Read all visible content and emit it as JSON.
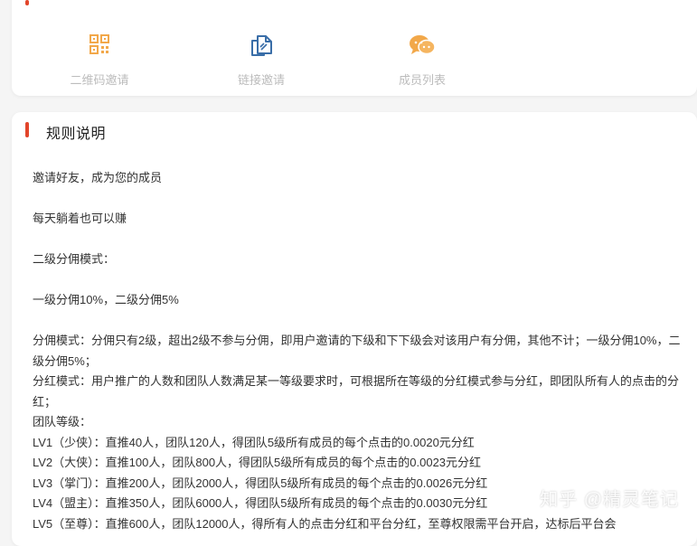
{
  "actions": {
    "qr_invite": {
      "label": "二维码邀请",
      "icon": "qr-code-icon",
      "color": "#f2a84a"
    },
    "link_invite": {
      "label": "链接邀请",
      "icon": "copy-link-icon",
      "color": "#3a6ea8"
    },
    "member_list": {
      "label": "成员列表",
      "icon": "chat-bubbles-icon",
      "color": "#f2a84a"
    }
  },
  "rules": {
    "title": "规则说明",
    "accent_color": "#e2452b",
    "lines": [
      "邀请好友，成为您的成员",
      "每天躺着也可以赚",
      "二级分佣模式：",
      "一级分佣10%，二级分佣5%",
      "分佣模式：分佣只有2级，超出2级不参与分佣，即用户邀请的下级和下下级会对该用户有分佣，其他不计；一级分佣10%，二级分佣5%；",
      "分红模式：用户推广的人数和团队人数满足某一等级要求时，可根据所在等级的分红模式参与分红，即团队所有人的点击的分红；",
      "团队等级：",
      "LV1（少侠）：直推40人，团队120人，得团队5级所有成员的每个点击的0.0020元分红",
      "LV2（大侠）：直推100人，团队800人，得团队5级所有成员的每个点击的0.0023元分红",
      "LV3（掌门）：直推200人，团队2000人，得团队5级所有成员的每个点击的0.0026元分红",
      "LV4（盟主）：直推350人，团队6000人，得团队5级所有成员的每个点击的0.0030元分红",
      "LV5（至尊）：直推600人，团队12000人，得所有人的点击分红和平台分红，至尊权限需平台开启，达标后平台会"
    ]
  },
  "watermark": "知乎 @精灵笔记"
}
